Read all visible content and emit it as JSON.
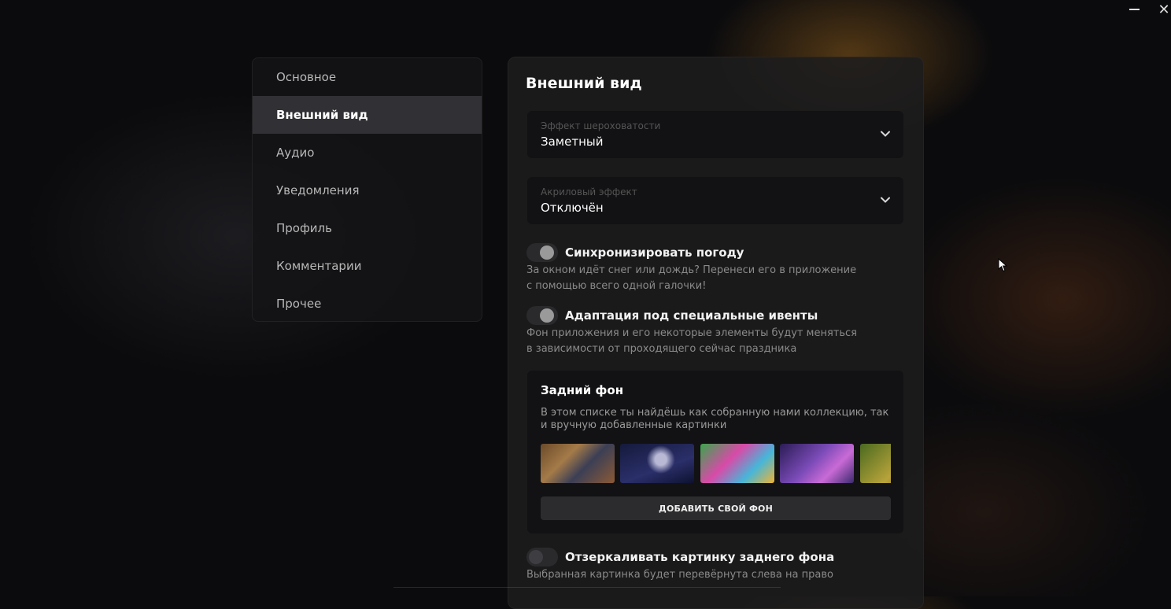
{
  "window": {
    "minimize_icon": "minimize-icon",
    "close_glyph": "✕"
  },
  "sidebar": {
    "items": [
      {
        "label": "Основное",
        "active": false
      },
      {
        "label": "Внешний вид",
        "active": true
      },
      {
        "label": "Аудио",
        "active": false
      },
      {
        "label": "Уведомления",
        "active": false
      },
      {
        "label": "Профиль",
        "active": false
      },
      {
        "label": "Комментарии",
        "active": false
      },
      {
        "label": "Прочее",
        "active": false
      }
    ]
  },
  "panel": {
    "title": "Внешний вид",
    "roughness": {
      "label": "Эффект шероховатости",
      "value": "Заметный"
    },
    "acrylic": {
      "label": "Акриловый эффект",
      "value": "Отключён"
    },
    "weather": {
      "title": "Синхронизировать погоду",
      "desc": "За окном идёт снег или дождь? Перенеси его в приложение с помощью всего одной галочки!",
      "enabled": true
    },
    "events": {
      "title": "Адаптация под специальные ивенты",
      "desc": "Фон приложения и его некоторые элементы будут меняться в зависимости от проходящего сейчас праздника",
      "enabled": true
    },
    "background": {
      "title": "Задний фон",
      "desc": "В этом списке ты найдёшь как собранную нами коллекцию, так и вручную добавленные картинки",
      "add_button": "ДОБАВИТЬ СВОЙ ФОН",
      "thumbnails": 5
    },
    "mirror": {
      "title": "Отзеркаливать картинку заднего фона",
      "desc": "Выбранная картинка будет перевёрнута слева на право",
      "enabled": false
    }
  },
  "colors": {
    "background": "#0b0b0d",
    "panel": "#1c1c1e",
    "field": "#121214",
    "active_nav": "#3c3c40",
    "text_muted": "#8a8a8a"
  }
}
